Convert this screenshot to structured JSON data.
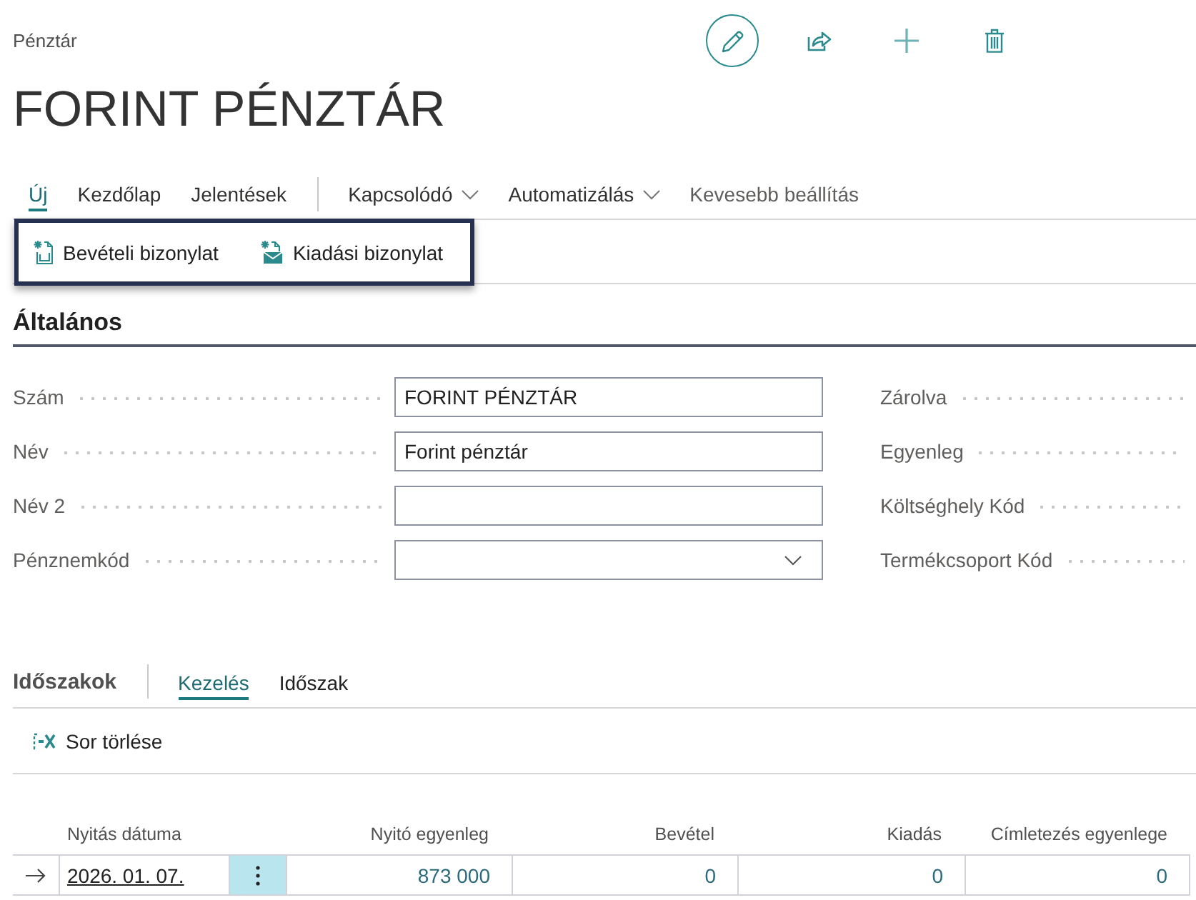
{
  "breadcrumb": "Pénztár",
  "title": "FORINT PÉNZTÁR",
  "action_bar": {
    "items": [
      {
        "label": "Új",
        "kind": "tab",
        "selected": true
      },
      {
        "label": "Kezdőlap",
        "kind": "tab",
        "selected": false
      },
      {
        "label": "Jelentések",
        "kind": "tab",
        "selected": false
      },
      {
        "label": "Kapcsolódó",
        "kind": "menu",
        "selected": false
      },
      {
        "label": "Automatizálás",
        "kind": "menu",
        "selected": false
      },
      {
        "label": "Kevesebb beállítás",
        "kind": "link",
        "selected": false
      }
    ],
    "actions": [
      {
        "label": "Bevételi bizonylat"
      },
      {
        "label": "Kiadási bizonylat"
      }
    ],
    "highlighted": true
  },
  "general": {
    "title": "Általános",
    "fields_left": [
      {
        "label": "Szám",
        "kind": "text",
        "value": "FORINT PÉNZTÁR"
      },
      {
        "label": "Név",
        "kind": "text",
        "value": "Forint pénztár"
      },
      {
        "label": "Név 2",
        "kind": "text"
      },
      {
        "label": "Pénznemkód",
        "kind": "dropdown"
      }
    ],
    "fields_right": [
      {
        "label": "Zárolva"
      },
      {
        "label": "Egyenleg"
      },
      {
        "label": "Költséghely Kód"
      },
      {
        "label": "Termékcsoport Kód"
      }
    ]
  },
  "periods": {
    "title": "Időszakok",
    "tabs": [
      {
        "label": "Kezelés",
        "selected": true
      },
      {
        "label": "Időszak",
        "selected": false
      }
    ],
    "actions": [
      {
        "label": "Sor törlése"
      }
    ],
    "table": {
      "columns": [
        "Nyitás dátuma",
        "Nyitó egyenleg",
        "Bevétel",
        "Kiadás",
        "Címletezés egyenlege"
      ],
      "rows": [
        {
          "current": true,
          "cells": [
            "2026. 01. 07.",
            "873 000",
            "0",
            "0",
            "0"
          ]
        }
      ]
    }
  }
}
